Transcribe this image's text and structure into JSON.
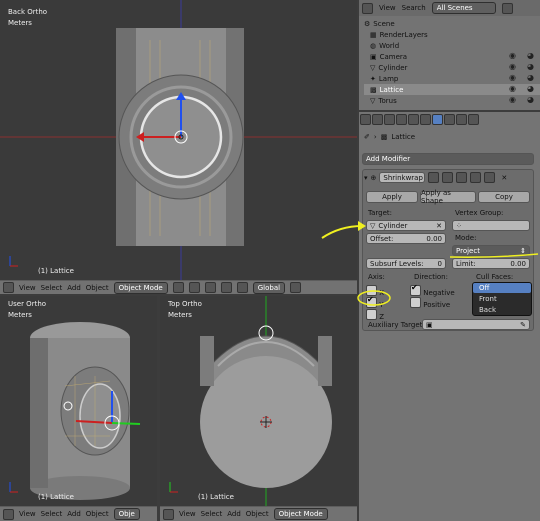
{
  "viewports": {
    "back": {
      "title": "Back Ortho",
      "units": "Meters",
      "object_label": "(1) Lattice"
    },
    "user": {
      "title": "User Ortho",
      "units": "Meters",
      "object_label": "(1) Lattice"
    },
    "top": {
      "title": "Top Ortho",
      "units": "Meters",
      "object_label": "(1) Lattice"
    }
  },
  "header_back": {
    "view": "View",
    "select": "Select",
    "add": "Add",
    "object": "Object",
    "mode": "Object Mode",
    "orientation": "Global"
  },
  "header_user": {
    "view": "View",
    "select": "Select",
    "add": "Add",
    "object": "Object",
    "mode": "Obje"
  },
  "header_top": {
    "view": "View",
    "select": "Select",
    "add": "Add",
    "object": "Object",
    "mode": "Object Mode"
  },
  "outliner": {
    "view": "View",
    "search": "Search",
    "filter": "All Scenes",
    "items": [
      {
        "label": "Scene"
      },
      {
        "label": "RenderLayers"
      },
      {
        "label": "World"
      },
      {
        "label": "Camera"
      },
      {
        "label": "Cylinder"
      },
      {
        "label": "Lamp"
      },
      {
        "label": "Lattice"
      },
      {
        "label": "Torus"
      }
    ]
  },
  "properties": {
    "object_name": "Lattice",
    "add_modifier": "Add Modifier",
    "modifier": {
      "name": "Shrinkwrap",
      "apply": "Apply",
      "apply_as_shape": "Apply as Shape",
      "copy": "Copy",
      "target_label": "Target:",
      "target_value": "Cylinder",
      "vertex_group_label": "Vertex Group:",
      "offset_label": "Offset:",
      "offset_value": "0.00",
      "mode_label": "Mode:",
      "mode_value": "Project",
      "subsurf_label": "Subsurf Levels:",
      "subsurf_value": "0",
      "limit_label": "Limit:",
      "limit_value": "0.00",
      "axis_label": "Axis:",
      "axis_x": "X",
      "axis_y": "Y",
      "axis_z": "Z",
      "direction_label": "Direction:",
      "negative": "Negative",
      "positive": "Positive",
      "cull_faces_label": "Cull Faces:",
      "cull_options": [
        "Off",
        "Front",
        "Back"
      ],
      "aux_target_label": "Auxiliary Target:"
    }
  },
  "colors": {
    "annotation": "#f0f020",
    "selected": "#5680c2",
    "x_axis": "#cc2020",
    "y_axis": "#20cc20",
    "z_axis": "#2050ee"
  }
}
